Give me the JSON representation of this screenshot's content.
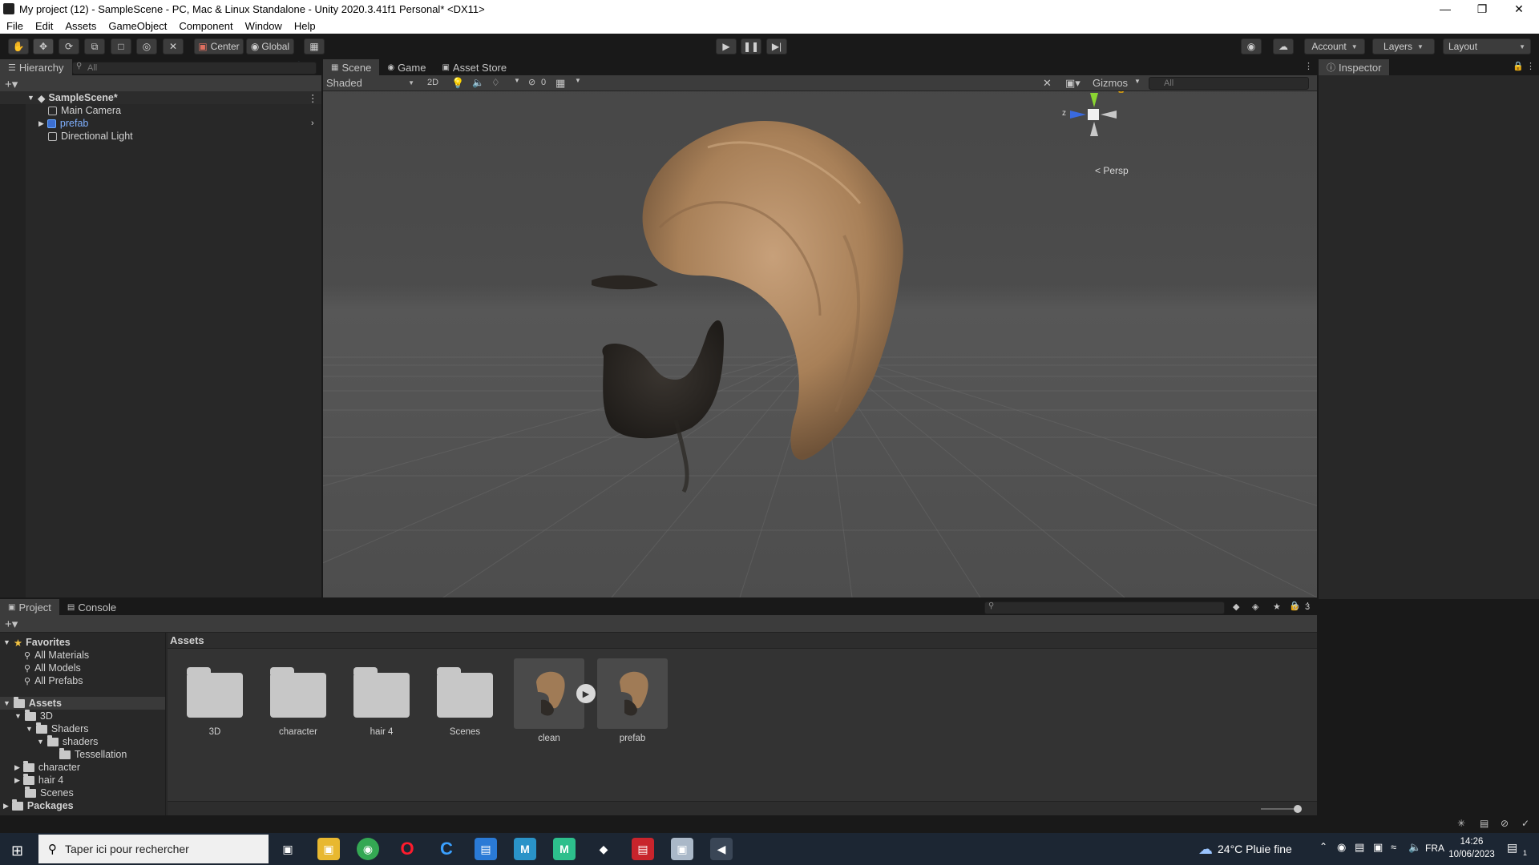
{
  "window": {
    "title": "My project (12) - SampleScene - PC, Mac & Linux Standalone - Unity 2020.3.41f1 Personal* <DX11>"
  },
  "menu": [
    "File",
    "Edit",
    "Assets",
    "GameObject",
    "Component",
    "Window",
    "Help"
  ],
  "toolbar": {
    "pivot": "Center",
    "space": "Global",
    "account": "Account",
    "layers": "Layers",
    "layout": "Layout"
  },
  "hierarchy": {
    "tab": "Hierarchy",
    "search_placeholder": "All",
    "scene": "SampleScene*",
    "items": [
      "Main Camera",
      "prefab",
      "Directional Light"
    ]
  },
  "scene_tabs": [
    "Scene",
    "Game",
    "Asset Store"
  ],
  "scene_toolbar": {
    "draw_mode": "Shaded",
    "mode_2d": "2D",
    "hidden_count": "0",
    "gizmos": "Gizmos",
    "search_placeholder": "All",
    "camera_mode": "< Persp",
    "axis_y": "y",
    "axis_z": "z"
  },
  "inspector": {
    "tab": "Inspector"
  },
  "project": {
    "tabs": [
      "Project",
      "Console"
    ],
    "visible_count": "3",
    "favorites_label": "Favorites",
    "favorites": [
      "All Materials",
      "All Models",
      "All Prefabs"
    ],
    "assets_root": "Assets",
    "tree": [
      "3D",
      "Shaders",
      "shaders",
      "Tessellation",
      "character",
      "hair 4",
      "Scenes"
    ],
    "packages": "Packages",
    "breadcrumb": "Assets",
    "tiles": [
      "3D",
      "character",
      "hair 4",
      "Scenes",
      "clean",
      "prefab"
    ]
  },
  "taskbar": {
    "search_placeholder": "Taper ici pour rechercher",
    "weather": "24°C  Pluie fine",
    "language": "FRA",
    "time": "14:26",
    "date": "10/06/2023",
    "notifications": "1"
  },
  "colors": {
    "hair": "#b08862",
    "beard": "#2e2a26",
    "selected_blue": "#4e8ef7",
    "scene_bg": "#4b4b4b"
  }
}
